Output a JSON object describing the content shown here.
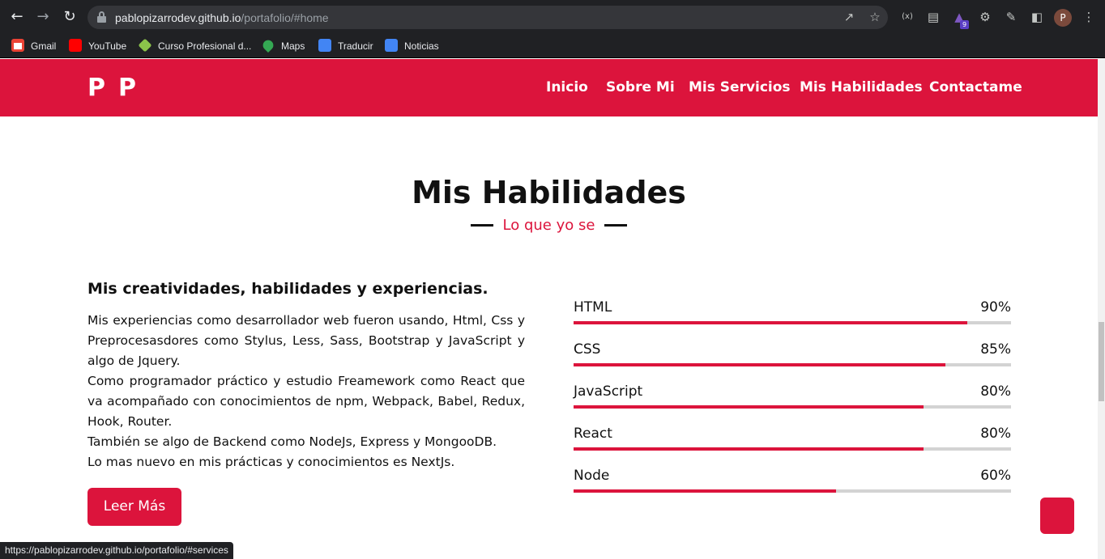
{
  "browser": {
    "url_host": "pablopizarrodev.github.io",
    "url_path": "/portafolio/#home",
    "profile_initial": "P",
    "extension_badge": "9",
    "bookmarks": [
      {
        "label": "Gmail",
        "icon": "gmail-icon",
        "color": "#ea4335"
      },
      {
        "label": "YouTube",
        "icon": "youtube-icon",
        "color": "#ff0000"
      },
      {
        "label": "Curso Profesional d...",
        "icon": "diamond-icon",
        "color": "#8bc34a"
      },
      {
        "label": "Maps",
        "icon": "maps-pin-icon",
        "color": "#34a853"
      },
      {
        "label": "Traducir",
        "icon": "translate-icon",
        "color": "#4285f4"
      },
      {
        "label": "Noticias",
        "icon": "news-icon",
        "color": "#4285f4"
      }
    ],
    "status_url": "https://pablopizarrodev.github.io/portafolio/#services"
  },
  "site": {
    "logo": "PP",
    "accent_color": "#dc143c",
    "nav": [
      "Inicio",
      "Sobre Mi",
      "Mis Servicios",
      "Mis Habilidades",
      "Contactame"
    ]
  },
  "skills_section": {
    "title": "Mis Habilidades",
    "subtitle": "Lo que yo se",
    "heading": "Mis creatividades, habilidades y experiencias.",
    "paragraphs": [
      "Mis experiencias como desarrollador web fueron usando, Html, Css y Preprocesasdores como Stylus, Less, Sass, Bootstrap y JavaScript y algo de Jquery.",
      "Como programador práctico y estudio Freamework como React que va acompañado con conocimientos de npm, Webpack, Babel, Redux, Hook, Router.",
      "También se algo de Backend como NodeJs, Express y MongooDB.",
      "Lo mas nuevo en mis prácticas y conocimientos es NextJs."
    ],
    "button_label": "Leer Más",
    "skills": [
      {
        "name": "HTML",
        "percent_label": "90%",
        "level": 0.9
      },
      {
        "name": "CSS",
        "percent_label": "85%",
        "level": 0.85
      },
      {
        "name": "JavaScript",
        "percent_label": "80%",
        "level": 0.8
      },
      {
        "name": "React",
        "percent_label": "80%",
        "level": 0.8
      },
      {
        "name": "Node",
        "percent_label": "60%",
        "level": 0.6
      }
    ]
  }
}
